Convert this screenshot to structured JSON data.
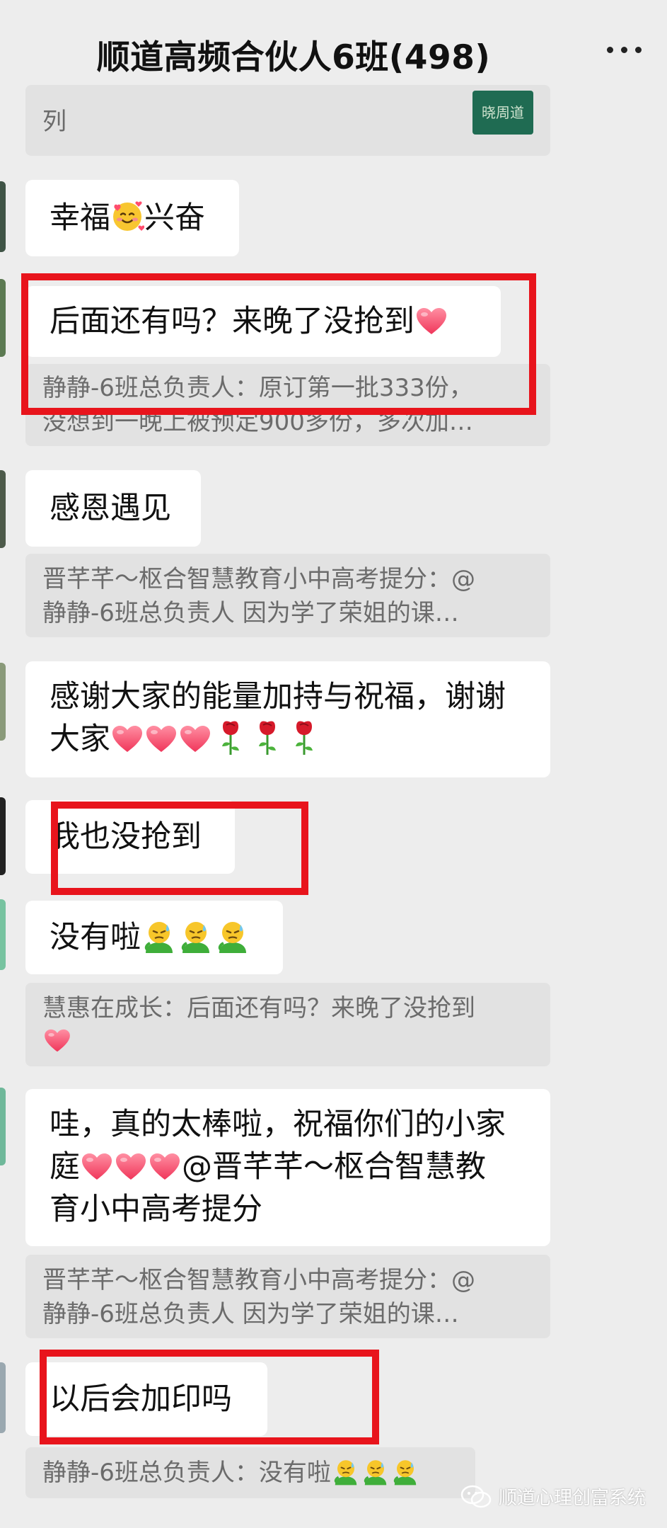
{
  "header": {
    "title": "顺道高频合伙人6班(498)",
    "more_icon": "more-dots-icon"
  },
  "messages": {
    "top_quote_fragment": "列",
    "top_quote_thumb": "晓周道",
    "m1": {
      "before": "幸福",
      "after": "兴奋"
    },
    "m2": {
      "text": "后面还有吗？来晚了没抢到"
    },
    "q2": {
      "line1": "静静-6班总负责人：原订第一批333份，",
      "line2": "没想到一晚上被预定900多份，多次加…"
    },
    "m3": {
      "text": "感恩遇见"
    },
    "q3": {
      "line1": "晋芊芊～枢合智慧教育小中高考提分：@",
      "line2": "静静-6班总负责人 因为学了荣姐的课…"
    },
    "m4": {
      "line1": "感谢大家的能量加持与祝福，谢谢",
      "line2": "大家"
    },
    "m5": {
      "text": "我也没抢到"
    },
    "m6": {
      "text": "没有啦"
    },
    "q6": {
      "line1": "慧惠在成长：后面还有吗？来晚了没抢到"
    },
    "m7": {
      "line1": "哇，真的太棒啦，祝福你们的小家",
      "line2_before": "庭",
      "line2_after": "@晋芊芊～枢合智慧教",
      "line3": "育小中高考提分"
    },
    "q7": {
      "line1": "晋芊芊～枢合智慧教育小中高考提分：@",
      "line2": "静静-6班总负责人 因为学了荣姐的课…"
    },
    "m8": {
      "text": "以后会加印吗"
    },
    "q8": {
      "text": "静静-6班总负责人：没有啦"
    }
  },
  "watermark": {
    "text": "顺道心理创富系统"
  },
  "colors": {
    "background": "#ededed",
    "bubble": "#ffffff",
    "quote_bg": "#e2e2e2",
    "highlight_box": "#e8141c",
    "heart": "#ff4d6d"
  }
}
